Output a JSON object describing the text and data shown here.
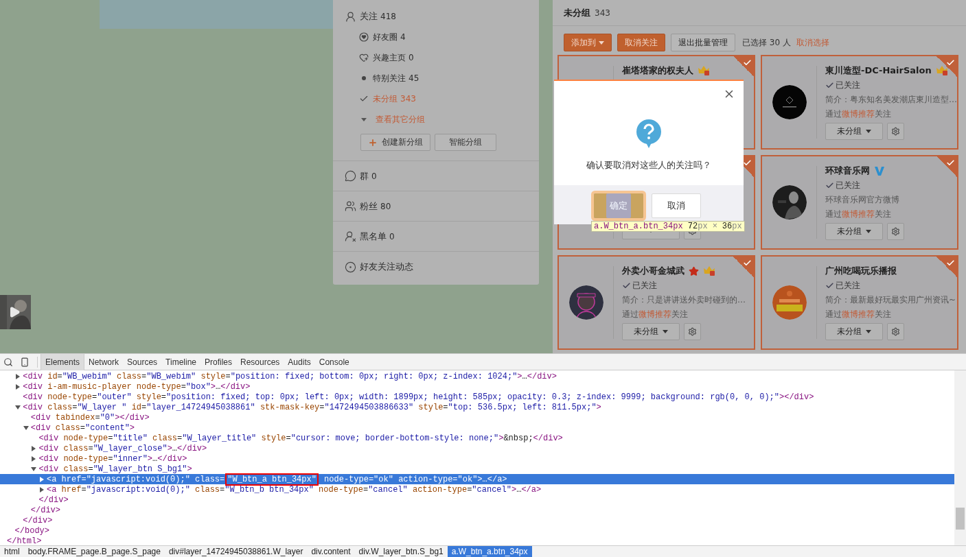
{
  "sidebar": {
    "sections": [
      {
        "kind": "follow",
        "label": "关注",
        "count": "418",
        "selected": false,
        "groups": [
          {
            "kind": "friends",
            "label": "好友圈",
            "count": "4",
            "selected": false
          },
          {
            "kind": "interest",
            "label": "兴趣主页",
            "count": "0",
            "selected": false
          },
          {
            "kind": "special",
            "label": "特别关注",
            "count": "45",
            "selected": false
          },
          {
            "kind": "ungrouped",
            "label": "未分组",
            "count": "343",
            "selected": true
          },
          {
            "kind": "more",
            "label": "查看其它分组"
          }
        ],
        "actions": [
          {
            "kind": "create",
            "label": "创建新分组"
          },
          {
            "kind": "smart",
            "label": "智能分组"
          }
        ]
      },
      {
        "kind": "groups",
        "label": "群",
        "count": "0",
        "selected": false
      },
      {
        "kind": "fans",
        "label": "粉丝",
        "count": "80",
        "selected": false
      },
      {
        "kind": "blocked",
        "label": "黑名单",
        "count": "0",
        "selected": false
      },
      {
        "kind": "feed",
        "label": "好友关注动态",
        "selected": false
      }
    ]
  },
  "main": {
    "title": "未分组",
    "count": "343",
    "toolbar": [
      {
        "kind": "dropdown",
        "label": "添加到"
      },
      {
        "kind": "primary",
        "label": "取消关注"
      },
      {
        "kind": "default",
        "label": "退出批量管理"
      }
    ],
    "selection_text": "已选择 30 人",
    "clear_link": "取消选择",
    "cards": [
      {
        "name": "崔塔塔家的权夫人",
        "badges": [
          {
            "kind": "crown"
          }
        ],
        "selected": true
      },
      {
        "name": "東川造型-DC-HairSalon",
        "badges": [
          {
            "kind": "crown"
          }
        ],
        "followed": "已关注",
        "intro": "简介：粤东知名美发潮店東川造型…",
        "source": {
          "prefix": "通过",
          "link": "微博推荐",
          "suffix": "关注"
        },
        "group": "未分组",
        "selected": true
      },
      {
        "selected": true,
        "kind": "controls_only"
      },
      {
        "name": "环球音乐网",
        "badges": [
          {
            "kind": "verified"
          }
        ],
        "followed": "已关注",
        "intro": "环球音乐网官方微博",
        "source": {
          "prefix": "通过",
          "link": "微博推荐",
          "suffix": "关注"
        },
        "group": "未分组",
        "selected": true
      },
      {
        "name": "外卖小哥金城武",
        "badges": [
          {
            "kind": "star"
          },
          {
            "kind": "crown"
          }
        ],
        "followed": "已关注",
        "intro": "简介：只是讲讲送外卖时碰到的…",
        "source": {
          "prefix": "通过",
          "link": "微博推荐",
          "suffix": "关注"
        },
        "group": "未分组",
        "selected": true
      },
      {
        "name": "广州吃喝玩乐播报",
        "followed": "已关注",
        "intro": "简介：最新最好玩最实用广州资讯~",
        "source": {
          "prefix": "通过",
          "link": "微博推荐",
          "suffix": "关注"
        },
        "group": "未分组",
        "selected": true
      }
    ]
  },
  "dialog": {
    "message": "确认要取消对这些人的关注吗？",
    "buttons": [
      {
        "kind": "primary",
        "label": "确定",
        "inspected": true
      },
      {
        "kind": "default",
        "label": "取消",
        "inspected": false
      }
    ],
    "tooltip": {
      "selector": "a.W_btn_a.btn_34px",
      "size": [
        {
          "value": "72",
          "unit": "px"
        },
        {
          "value": "36",
          "unit": "px"
        }
      ],
      "times": "×"
    }
  },
  "devtools": {
    "tabs": [
      {
        "label": "Elements",
        "selected": true
      },
      {
        "label": "Network",
        "selected": false
      },
      {
        "label": "Sources",
        "selected": false
      },
      {
        "label": "Timeline",
        "selected": false
      },
      {
        "label": "Profiles",
        "selected": false
      },
      {
        "label": "Resources",
        "selected": false
      },
      {
        "label": "Audits",
        "selected": false
      },
      {
        "label": "Console",
        "selected": false
      }
    ],
    "tree": [
      {
        "selected": false,
        "close": "</html>",
        "children": [
          {
            "selected": false,
            "close": "</body>",
            "children": [
              {
                "text": "<div id=\"WB_webim\" class=\"WB_webim\" style=\"position: fixed; bottom: 0px; right: 0px; z-index: 1024;\">…</div>",
                "expanded": false,
                "selected": false
              },
              {
                "text": "<div i-am-music-player node-type=\"box\">…</div>",
                "expanded": false,
                "selected": false
              },
              {
                "text": "<div node-type=\"outer\" style=\"position: fixed; top: 0px; left: 0px; width: 1899px; height: 585px; opacity: 0.3; z-index: 9999; background: rgb(0, 0, 0);\"></div>",
                "selected": false
              },
              {
                "text": "<div class=\"W_layer \" id=\"layer_14724945038861\" stk-mask-key=\"1472494503886633\" style=\"top: 536.5px; left: 811.5px;\">",
                "expanded": true,
                "selected": false,
                "close": "</div>",
                "children": [
                  {
                    "text": "<div tabindex=\"0\"></div>",
                    "selected": false
                  },
                  {
                    "text": "<div class=\"content\">",
                    "expanded": true,
                    "selected": false,
                    "close": "</div>",
                    "children": [
                      {
                        "text": "<div node-type=\"title\" class=\"W_layer_title\" style=\"cursor: move; border-bottom-style: none;\">&nbsp;</div>",
                        "selected": false
                      },
                      {
                        "text": "<div class=\"W_layer_close\">…</div>",
                        "expanded": false,
                        "selected": false
                      },
                      {
                        "text": "<div node-type=\"inner\">…</div>",
                        "expanded": false,
                        "selected": false
                      },
                      {
                        "text": "<div class=\"W_layer_btn S_bg1\">",
                        "expanded": true,
                        "selected": false,
                        "close": "</div>",
                        "children": [
                          {
                            "text": "<a href=\"javascript:void(0);\" class=",
                            "boxed_text": "\"W_btn_a btn_34px\"",
                            "text_after": " node-type=\"ok\" action-type=\"ok\">…</a>",
                            "expanded": false,
                            "selected": true
                          },
                          {
                            "text": "<a href=\"javascript:void(0);\" class=\"W_btn_b btn_34px\" node-type=\"cancel\" action-type=\"cancel\">…</a>",
                            "expanded": false,
                            "selected": false
                          }
                        ]
                      }
                    ]
                  }
                ]
              }
            ]
          }
        ]
      }
    ],
    "breadcrumbs": [
      {
        "label": "html",
        "selected": false
      },
      {
        "label": "body.FRAME_page.B_page.S_page",
        "selected": false
      },
      {
        "label": "div#layer_14724945038861.W_layer",
        "selected": false
      },
      {
        "label": "div.content",
        "selected": false
      },
      {
        "label": "div.W_layer_btn.S_bg1",
        "selected": false
      },
      {
        "label": "a.W_btn_a.btn_34px",
        "selected": true
      }
    ]
  }
}
